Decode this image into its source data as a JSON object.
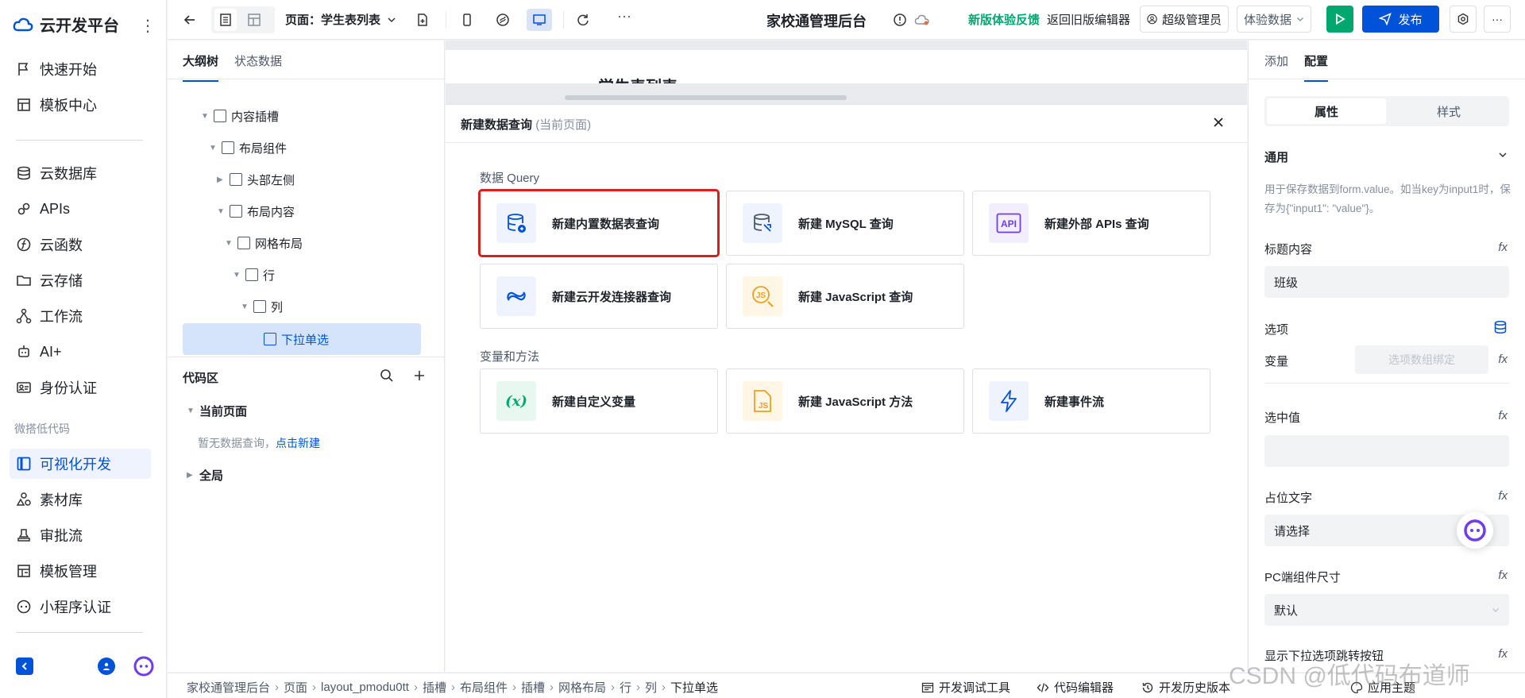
{
  "sidebar": {
    "brand": "云开发平台",
    "more": "⋮",
    "items": [
      {
        "label": "快速开始",
        "icon": "flag-icon"
      },
      {
        "label": "模板中心",
        "icon": "template-icon"
      },
      {
        "label": "云数据库",
        "icon": "database-icon"
      },
      {
        "label": "APIs",
        "icon": "link-icon"
      },
      {
        "label": "云函数",
        "icon": "function-icon"
      },
      {
        "label": "云存储",
        "icon": "folder-icon"
      },
      {
        "label": "工作流",
        "icon": "workflow-icon"
      },
      {
        "label": "AI+",
        "icon": "ai-icon"
      },
      {
        "label": "身份认证",
        "icon": "id-card-icon"
      }
    ],
    "section_label": "微搭低代码",
    "low_code_items": [
      {
        "label": "可视化开发",
        "icon": "layout-icon",
        "active": true
      },
      {
        "label": "素材库",
        "icon": "shapes-icon"
      },
      {
        "label": "审批流",
        "icon": "stamp-icon"
      },
      {
        "label": "模板管理",
        "icon": "template-manage-icon"
      },
      {
        "label": "小程序认证",
        "icon": "miniprogram-icon"
      }
    ]
  },
  "topbar": {
    "page_label": "页面：学生表列表",
    "app_title": "家校通管理后台",
    "feedback": "新版体验反馈",
    "back_old": "返回旧版编辑器",
    "user": "超级管理员",
    "data_env": "体验数据",
    "publish": "发布",
    "more": "···"
  },
  "outline": {
    "tabs": [
      "大纲树",
      "状态数据"
    ],
    "tree": [
      {
        "label": "内容插槽",
        "depth": 0
      },
      {
        "label": "布局组件",
        "depth": 1
      },
      {
        "label": "头部左侧",
        "depth": 2
      },
      {
        "label": "布局内容",
        "depth": 2
      },
      {
        "label": "网格布局",
        "depth": 3
      },
      {
        "label": "行",
        "depth": 4
      },
      {
        "label": "列",
        "depth": 5
      },
      {
        "label": "下拉单选",
        "depth": 6
      }
    ],
    "code_title": "代码区",
    "current_page": "当前页面",
    "empty_hint": "暂无数据查询，",
    "create_link": "点击新建",
    "global": "全局"
  },
  "canvas": {
    "peek_title": "学生表列表"
  },
  "modal": {
    "title": "新建数据查询",
    "title_suffix": "(当前页面)",
    "section_query": "数据 Query",
    "section_vars": "变量和方法",
    "query_cards": [
      {
        "label": "新建内置数据表查询",
        "icon": "builtin-db-icon"
      },
      {
        "label": "新建 MySQL 查询",
        "icon": "mysql-icon"
      },
      {
        "label": "新建外部 APIs 查询",
        "icon": "api-icon"
      },
      {
        "label": "新建云开发连接器查询",
        "icon": "connector-icon"
      },
      {
        "label": "新建 JavaScript 查询",
        "icon": "js-query-icon"
      }
    ],
    "var_cards": [
      {
        "label": "新建自定义变量",
        "icon": "variable-icon"
      },
      {
        "label": "新建 JavaScript 方法",
        "icon": "js-file-icon"
      },
      {
        "label": "新建事件流",
        "icon": "lightning-icon"
      }
    ]
  },
  "right": {
    "tabs": [
      "添加",
      "配置"
    ],
    "seg": [
      "属性",
      "样式"
    ],
    "general": "通用",
    "hint": "用于保存数据到form.value。如当key为input1时，保存为{\"input1\": \"value\"}。",
    "fields": {
      "title_label": "标题内容",
      "title_value": "班级",
      "options_label": "选项",
      "variable_label": "变量",
      "variable_placeholder": "选项数组绑定",
      "selected_label": "选中值",
      "placeholder_label": "占位文字",
      "placeholder_value": "请选择",
      "size_label": "PC端组件尺寸",
      "size_value": "默认",
      "jump_label": "显示下拉选项跳转按钮"
    },
    "fx": "fx"
  },
  "statusbar": {
    "crumbs": [
      "家校通管理后台",
      "页面",
      "layout_pmodu0tt",
      "插槽",
      "布局组件",
      "插槽",
      "网格布局",
      "行",
      "列",
      "下拉单选"
    ],
    "dev_tools": "开发调试工具",
    "code_editor": "代码编辑器",
    "history": "开发历史版本",
    "theme": "应用主题"
  },
  "watermark": "CSDN @低代码布道师",
  "colors": {
    "primary": "#0052d9",
    "green": "#00a870",
    "highlight": "#d81e1e"
  }
}
